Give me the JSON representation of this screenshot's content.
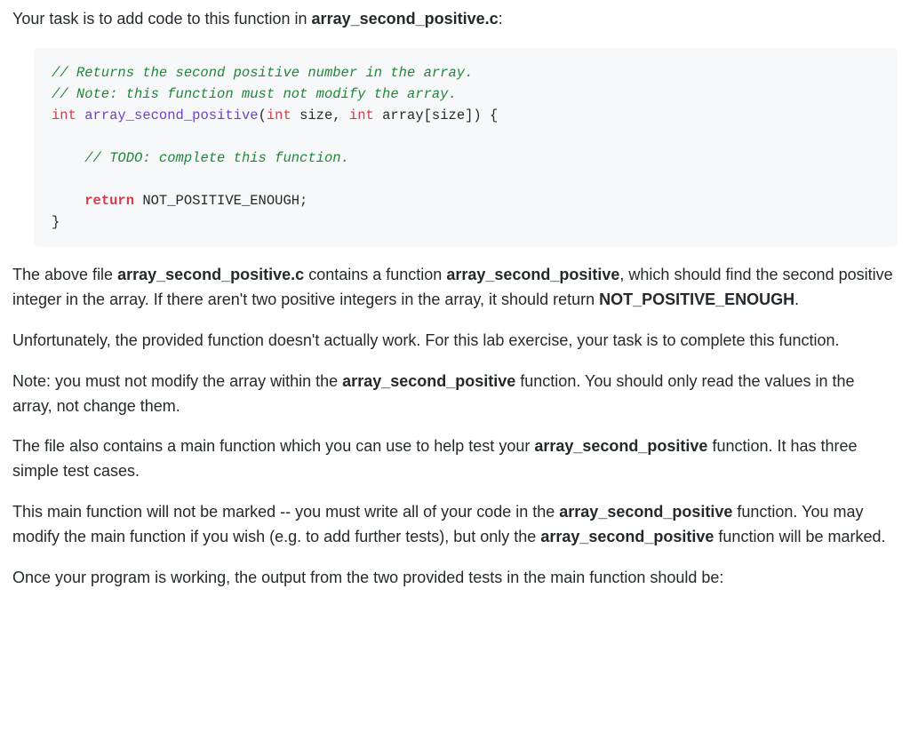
{
  "intro": {
    "prefix": "Your task is to add code to this function in ",
    "filename": "array_second_positive.c",
    "suffix": ":"
  },
  "code": {
    "c1": "// Returns the second positive number in the array.",
    "c2": "// Note: this function must not modify the array.",
    "sig_int1": "int",
    "sig_fn": "array_second_positive",
    "sig_open": "(",
    "sig_int2": "int",
    "sig_size": " size, ",
    "sig_int3": "int",
    "sig_arr": " array[size]) {",
    "todo": "// TODO: complete this function.",
    "ret_kw": "return",
    "ret_val": " NOT_POSITIVE_ENOUGH;",
    "close": "}"
  },
  "p1": {
    "t1": "The above file ",
    "b1": "array_second_positive.c",
    "t2": " contains a function ",
    "b2": "array_second_positive",
    "t3": ", which should find the second positive integer in the array. If there aren't two positive integers in the array, it should return ",
    "b3": "NOT_POSITIVE_ENOUGH",
    "t4": "."
  },
  "p2": "Unfortunately, the provided function doesn't actually work. For this lab exercise, your task is to complete this function.",
  "p3": {
    "t1": "Note: you must not modify the array within the ",
    "b1": "array_second_positive",
    "t2": " function. You should only read the values in the array, not change them."
  },
  "p4": {
    "t1": "The file also contains a main function which you can use to help test your ",
    "b1": "array_second_positive",
    "t2": " function. It has three simple test cases."
  },
  "p5": {
    "t1": "This main function will not be marked -- you must write all of your code in the ",
    "b1": "array_second_positive",
    "t2": " function. You may modify the main function if you wish (e.g. to add further tests), but only the ",
    "b2": "array_second_positive",
    "t3": " function will be marked."
  },
  "p6": "Once your program is working, the output from the two provided tests in the main function should be:"
}
